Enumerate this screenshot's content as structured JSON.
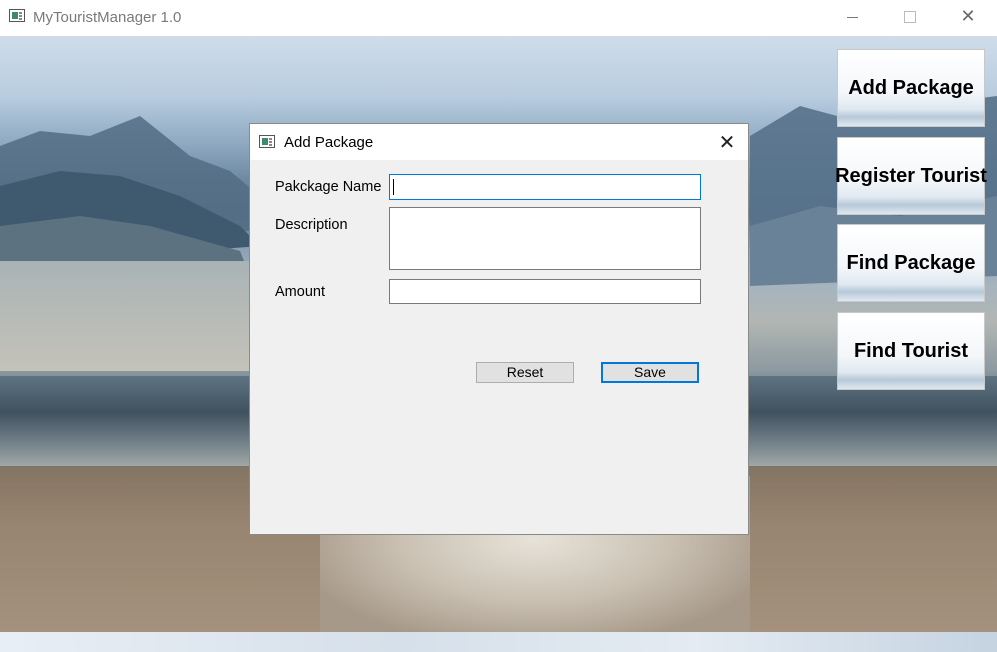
{
  "app": {
    "title": "MyTouristManager 1.0",
    "window_controls": {
      "minimize": "",
      "maximize": "",
      "close": "✕"
    }
  },
  "side_menu": {
    "items": [
      {
        "label": "Add Package"
      },
      {
        "label": "Register Tourist"
      },
      {
        "label": "Find Package"
      },
      {
        "label": "Find Tourist"
      }
    ]
  },
  "dialog": {
    "title": "Add Package",
    "close": "✕",
    "fields": {
      "package_name": {
        "label": "Pakckage Name",
        "value": ""
      },
      "description": {
        "label": "Description",
        "value": ""
      },
      "amount": {
        "label": "Amount",
        "value": ""
      }
    },
    "buttons": {
      "reset": "Reset",
      "save": "Save"
    }
  }
}
